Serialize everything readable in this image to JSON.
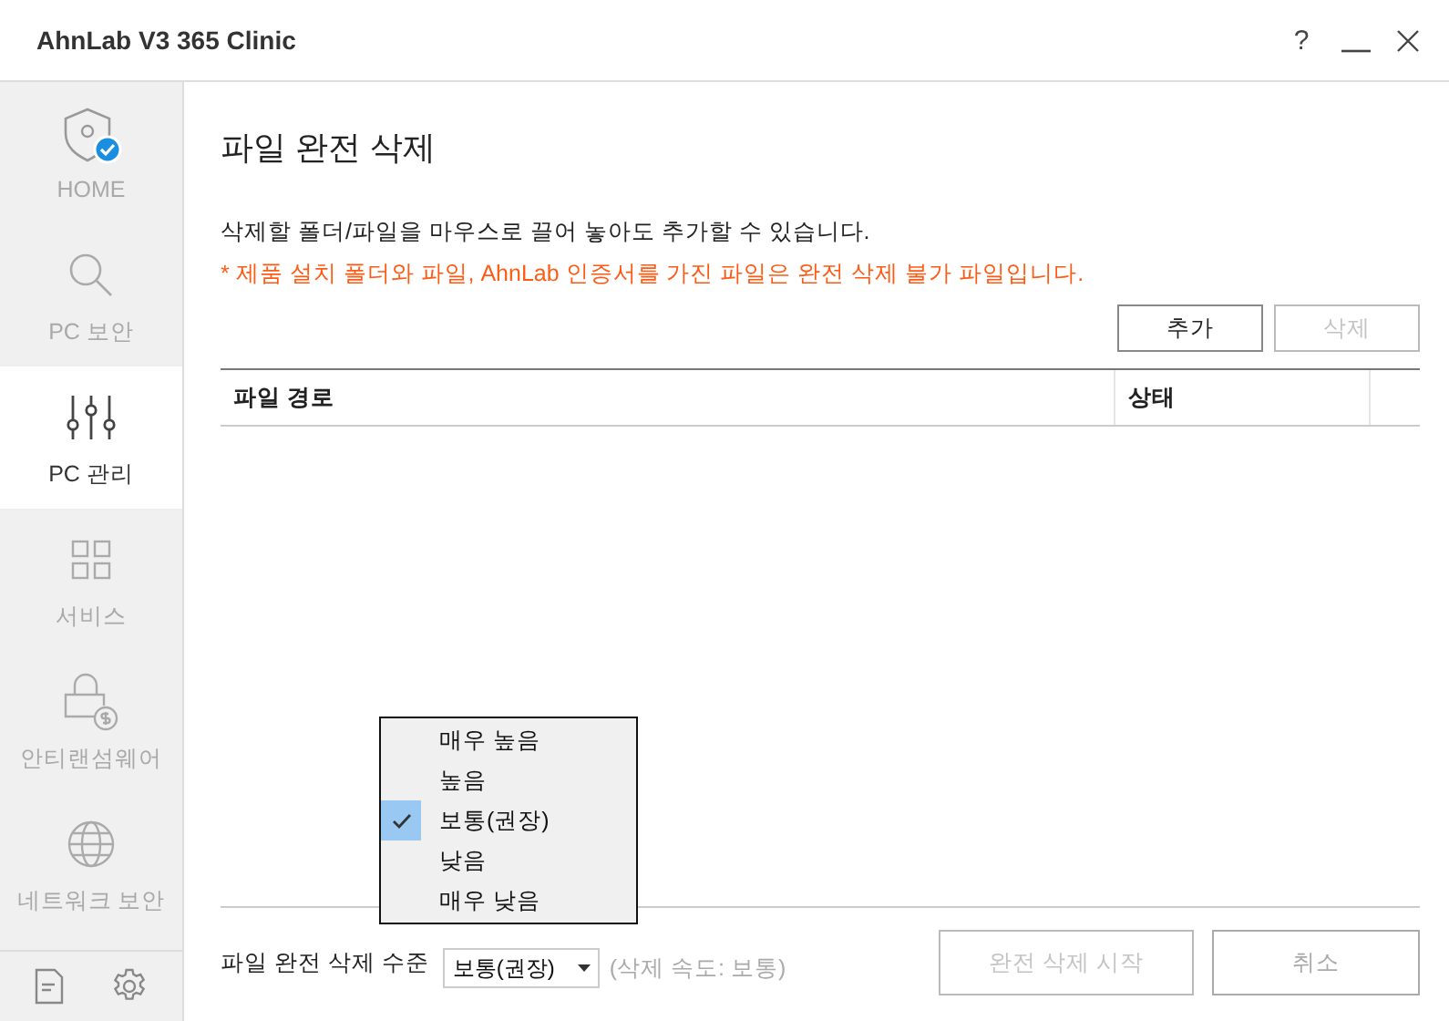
{
  "window": {
    "title": "AhnLab V3 365 Clinic",
    "controls": [
      "?"
    ]
  },
  "sidebar": {
    "items": [
      {
        "kind": "home",
        "label": "HOME",
        "selected": false,
        "badge": true
      },
      {
        "kind": "scan",
        "label": "PC 보안",
        "selected": false
      },
      {
        "kind": "manage",
        "label": "PC 관리",
        "selected": true
      },
      {
        "kind": "service",
        "label": "서비스",
        "selected": false
      },
      {
        "kind": "ransomware",
        "label": "안티랜섬웨어",
        "selected": false
      },
      {
        "kind": "network",
        "label": "네트워크 보안",
        "selected": false
      }
    ],
    "footer_icons": [
      {
        "kind": "document"
      },
      {
        "kind": "settings"
      }
    ]
  },
  "page": {
    "title": "파일 완전 삭제",
    "description": "삭제할 폴더/파일을 마우스로 끌어 놓아도 추가할 수 있습니다.",
    "warning": "* 제품 설치 폴더와 파일, AhnLab 인증서를 가진 파일은 완전 삭제 불가 파일입니다.",
    "actions": [
      {
        "label": "추가",
        "disabled": false
      },
      {
        "label": "삭제",
        "disabled": true
      }
    ],
    "table": {
      "columns": [
        "파일 경로",
        "상태"
      ]
    },
    "level": {
      "label": "파일 완전 삭제 수준",
      "value": "보통(권장)",
      "speed": "(삭제 속도: 보통)"
    },
    "dropdown": {
      "options": [
        {
          "label": "매우 높음",
          "selected": false
        },
        {
          "label": "높음",
          "selected": false
        },
        {
          "label": "보통(권장)",
          "selected": true
        },
        {
          "label": "낮음",
          "selected": false
        },
        {
          "label": "매우 낮음",
          "selected": false
        }
      ]
    },
    "buttons": [
      {
        "label": "완전 삭제 시작",
        "disabled": true
      },
      {
        "label": "취소",
        "disabled": false
      }
    ]
  }
}
